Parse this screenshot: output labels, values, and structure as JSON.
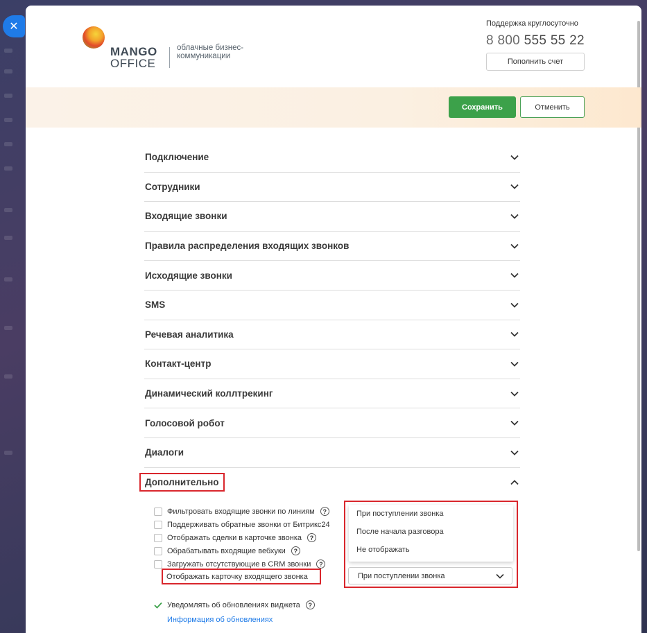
{
  "header": {
    "logo_line1": "MANGO",
    "logo_line2": "OFFICE",
    "logo_tagline": "облачные бизнес-коммуникации",
    "support_label": "Поддержка круглосуточно",
    "phone_prefix": "8 800",
    "phone_number": "555 55 22",
    "topup_label": "Пополнить счет"
  },
  "actions": {
    "save_label": "Сохранить",
    "cancel_label": "Отменить"
  },
  "accordion": {
    "items": [
      {
        "label": "Подключение"
      },
      {
        "label": "Сотрудники"
      },
      {
        "label": "Входящие звонки"
      },
      {
        "label": "Правила распределения входящих звонков"
      },
      {
        "label": "Исходящие звонки"
      },
      {
        "label": "SMS"
      },
      {
        "label": "Речевая аналитика"
      },
      {
        "label": "Контакт-центр"
      },
      {
        "label": "Динамический коллтрекинг"
      },
      {
        "label": "Голосовой робот"
      },
      {
        "label": "Диалоги"
      }
    ],
    "open_label": "Дополнительно"
  },
  "options": [
    {
      "label": "Фильтровать входящие звонки по линиям",
      "checked": false,
      "help": true
    },
    {
      "label": "Поддерживать обратные звонки от Битрикс24",
      "checked": false,
      "help": false
    },
    {
      "label": "Отображать сделки в карточке звонка",
      "checked": false,
      "help": true
    },
    {
      "label": "Обрабатывать входящие вебхуки",
      "checked": false,
      "help": true
    },
    {
      "label": "Загружать отсутствующие в CRM звонки",
      "checked": false,
      "help": true
    }
  ],
  "card_display": {
    "label": "Отображать карточку входящего звонка",
    "selected": "При поступлении звонка",
    "options": [
      "При поступлении звонка",
      "После начала разговора",
      "Не отображать"
    ]
  },
  "notify": {
    "label": "Уведомлять об обновлениях виджета",
    "checked": true,
    "link": "Информация об обновлениях"
  },
  "colors": {
    "accent_blue": "#1f7be8",
    "save_green": "#3ca14a",
    "highlight_red": "#d9262c"
  }
}
